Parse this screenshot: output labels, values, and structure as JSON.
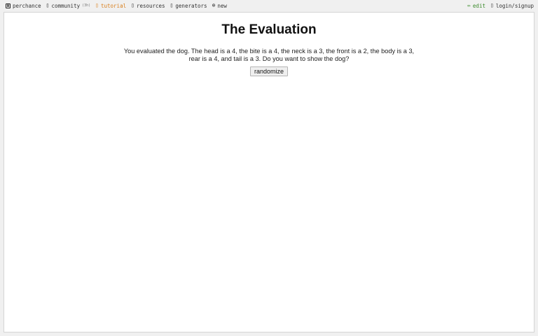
{
  "nav": {
    "left": [
      {
        "id": "perchance",
        "icon": "die-icon",
        "label": "perchance"
      },
      {
        "id": "community",
        "icon": "chat-icon",
        "label": "community",
        "badge": "(3h)"
      },
      {
        "id": "tutorial",
        "icon": "book-icon",
        "label": "tutorial",
        "color": "#d97f1c"
      },
      {
        "id": "resources",
        "icon": "doc-icon",
        "label": "resources"
      },
      {
        "id": "generators",
        "icon": "gear-icon",
        "label": "generators"
      },
      {
        "id": "new",
        "icon": "plus-circle-icon",
        "label": "new"
      }
    ],
    "right": [
      {
        "id": "edit",
        "icon": "pencil-icon",
        "label": "edit",
        "color": "#3a8a2a"
      },
      {
        "id": "login",
        "icon": "user-icon",
        "label": "login/signup"
      }
    ]
  },
  "main": {
    "title": "The Evaluation",
    "text": "You evaluated the dog. The head is a 4, the bite is a 4, the neck is a 3, the front is a 2, the body is a 3, rear is a 4, and tail is a 3. Do you want to show the dog?",
    "button_label": "randomize"
  }
}
